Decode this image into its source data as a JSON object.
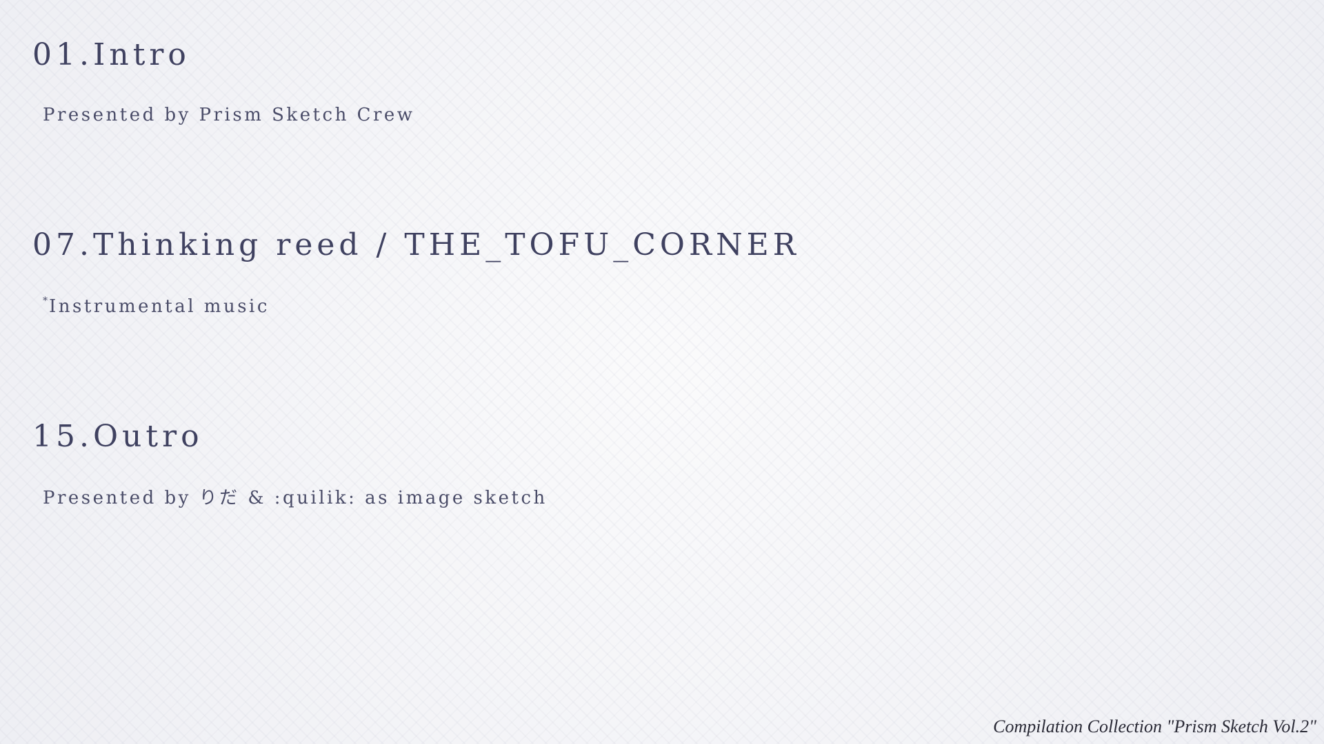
{
  "tracks": [
    {
      "title": "01.Intro",
      "credit": "Presented by Prism Sketch Crew"
    },
    {
      "title": "07.Thinking reed / THE_TOFU_CORNER",
      "credit_mark": "*",
      "credit": "Instrumental music"
    },
    {
      "title": "15.Outro",
      "credit": "Presented by りだ & :quilik: as image sketch"
    }
  ],
  "footer": {
    "caption": "Compilation Collection \"Prism Sketch Vol.2\""
  },
  "colors": {
    "background": "#f3f3f6",
    "text": "#3f4160",
    "caption": "#2a2a36"
  }
}
